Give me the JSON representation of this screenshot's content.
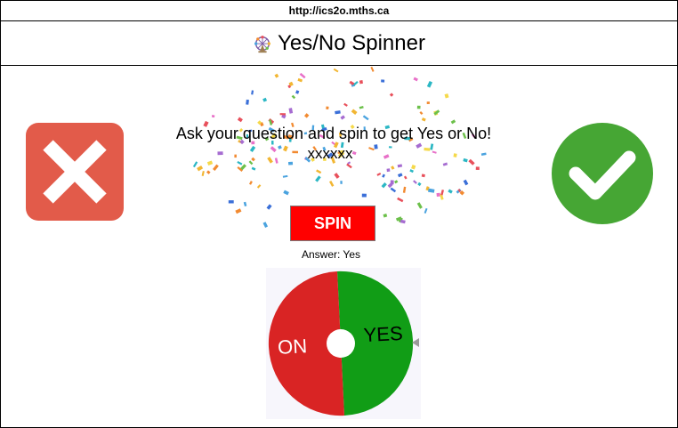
{
  "url": "http://ics2o.mths.ca",
  "header": {
    "icon": "ferris-wheel-icon",
    "title": "Yes/No Spinner"
  },
  "no_icon": {
    "icon": "x-mark-icon",
    "color": "#e25b4a"
  },
  "yes_icon": {
    "icon": "checkmark-icon",
    "color": "#46a634"
  },
  "question": {
    "prompt": "Ask your question and spin to get Yes or No!",
    "value": "xxxxxx"
  },
  "spin_button": {
    "label": "SPIN",
    "color": "#ff0000"
  },
  "answer": {
    "label": "Answer: Yes"
  },
  "spinner": {
    "segments": [
      {
        "label": "YES",
        "color": "#119d16",
        "text_color": "#000000"
      },
      {
        "label": "ON",
        "color": "#d92424",
        "text_color": "#ffffff"
      }
    ],
    "pointer": "pointer-arrow-icon"
  }
}
